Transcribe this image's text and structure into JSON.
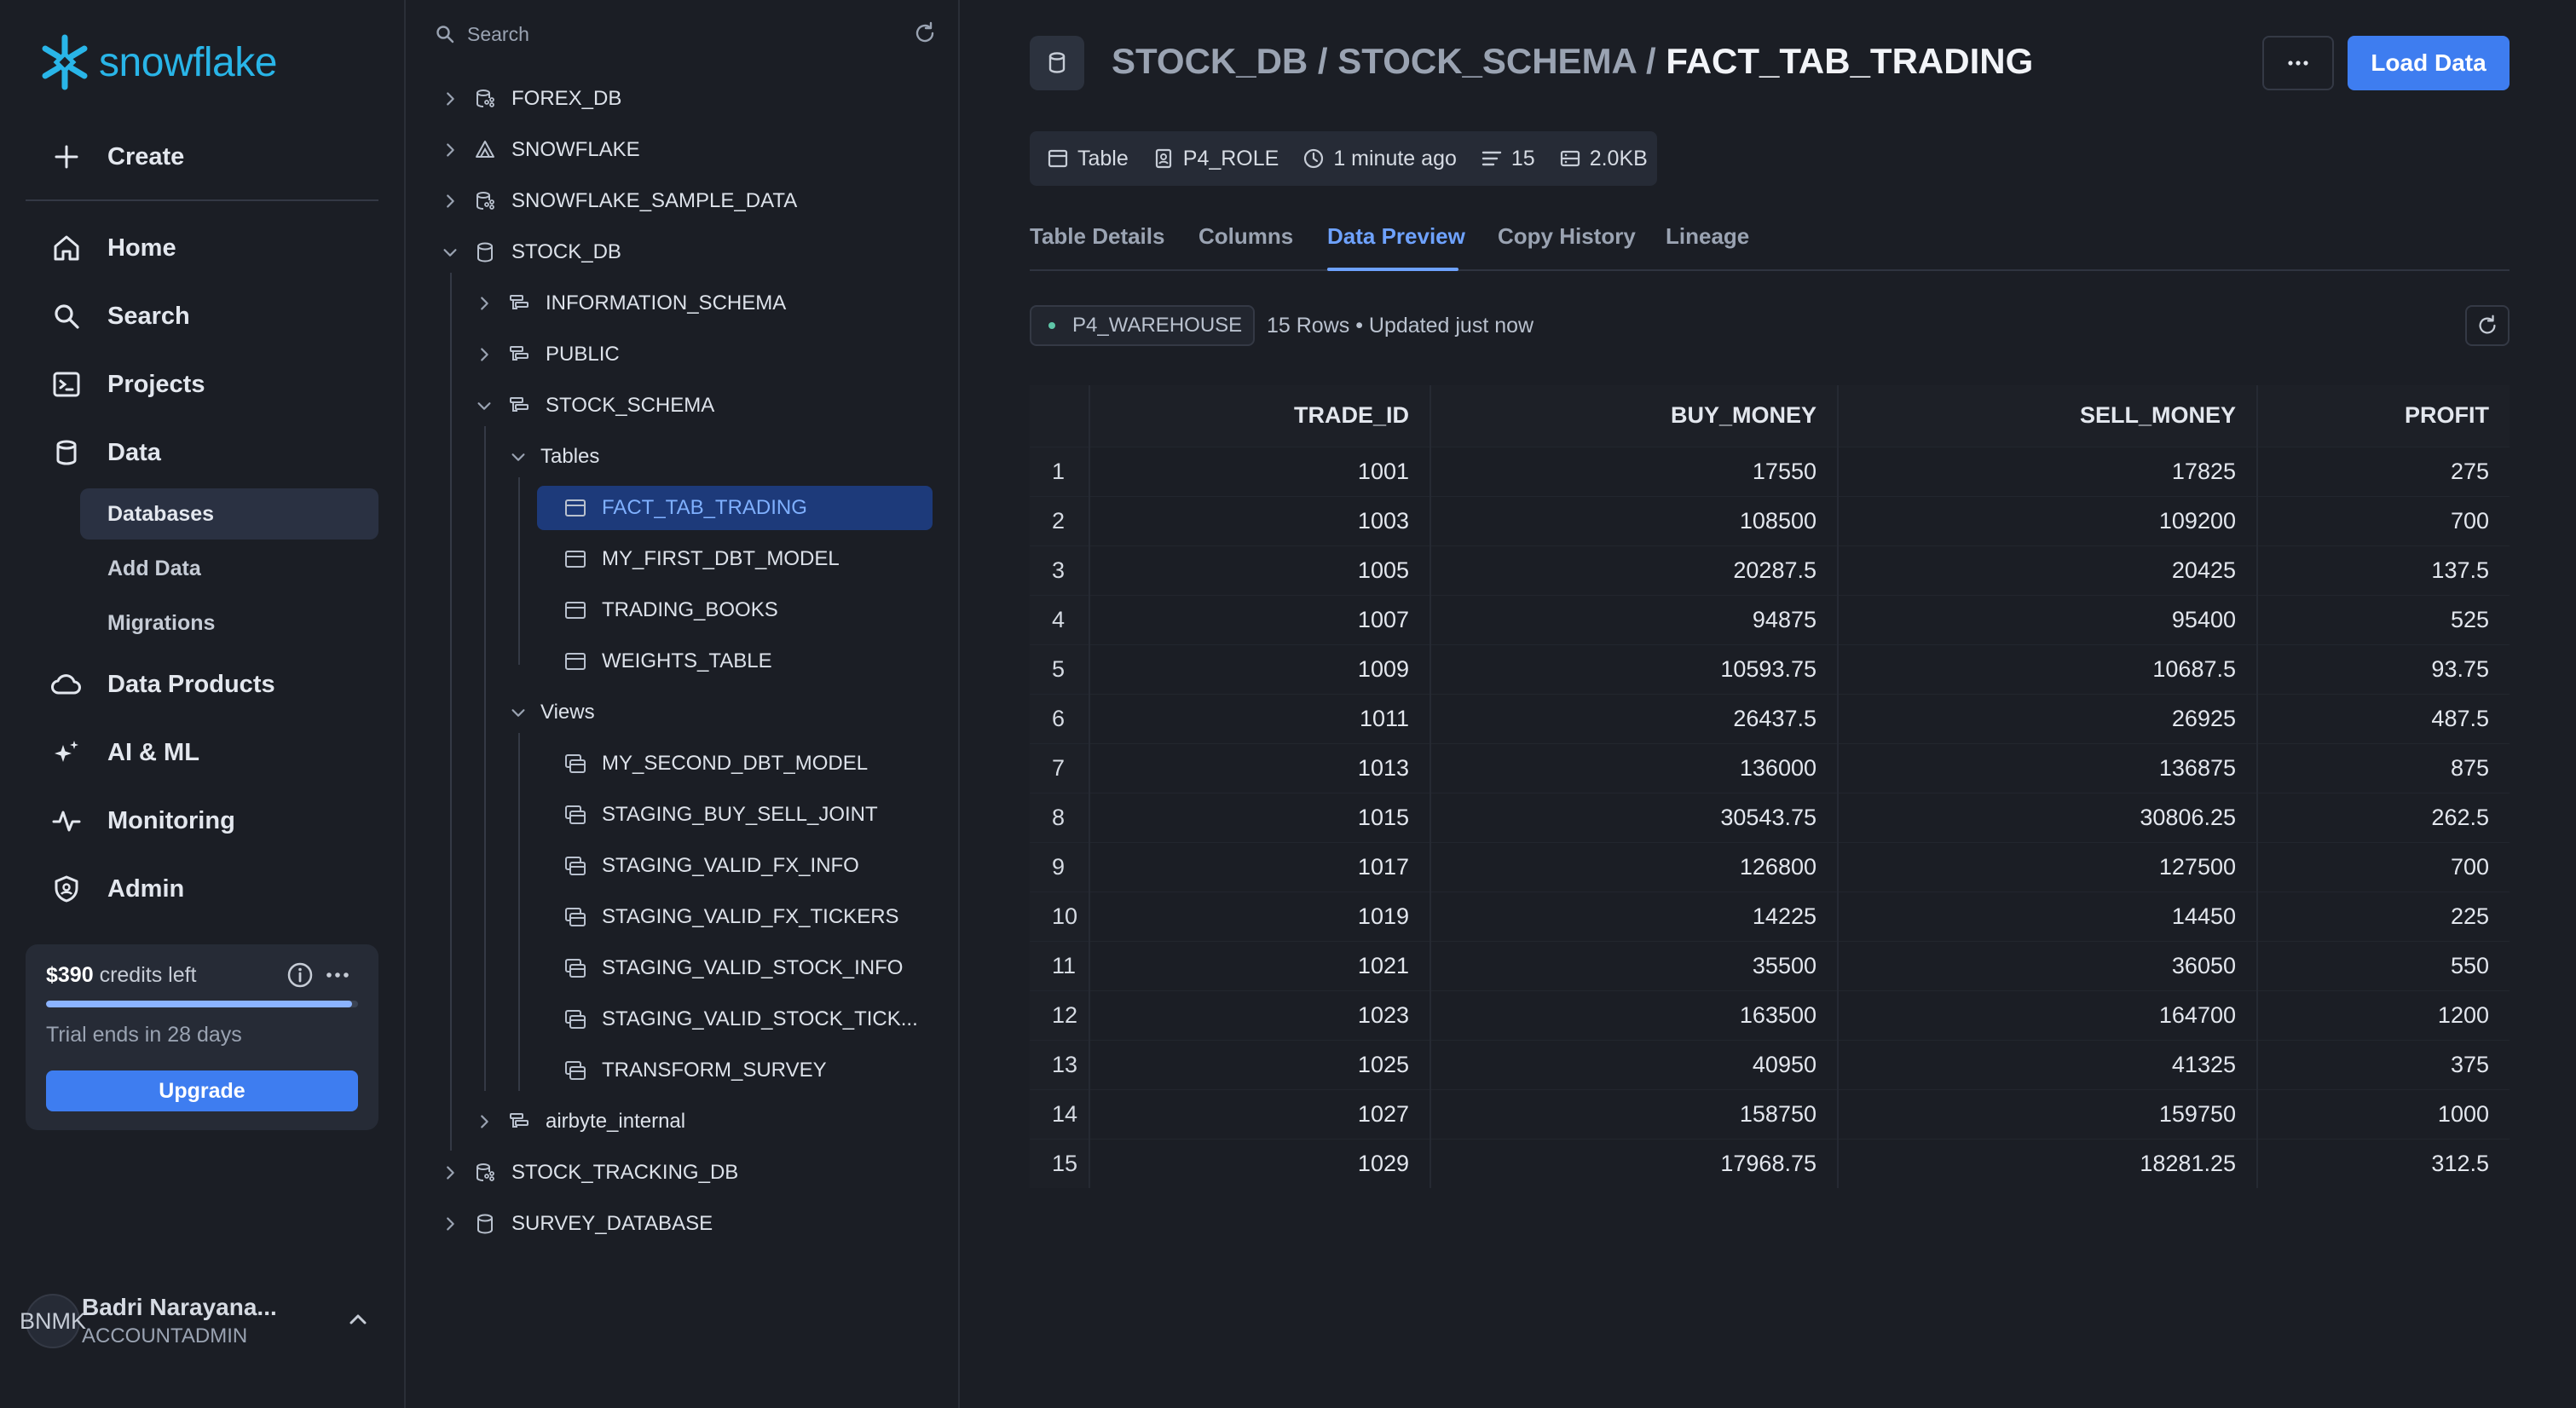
{
  "brand": {
    "logo_text": "snowflake",
    "accent": "#29b5e8"
  },
  "nav": {
    "create": "Create",
    "items": [
      {
        "label": "Home",
        "icon": "home-icon"
      },
      {
        "label": "Search",
        "icon": "search-icon"
      },
      {
        "label": "Projects",
        "icon": "terminal-icon"
      },
      {
        "label": "Data",
        "icon": "database-icon"
      }
    ],
    "data_sub": [
      "Databases",
      "Add Data",
      "Migrations"
    ],
    "items_after": [
      {
        "label": "Data Products",
        "icon": "cloud-icon"
      },
      {
        "label": "AI & ML",
        "icon": "sparkle-icon"
      },
      {
        "label": "Monitoring",
        "icon": "pulse-icon"
      },
      {
        "label": "Admin",
        "icon": "shield-icon"
      }
    ]
  },
  "credits": {
    "amount": "$390",
    "suffix": "credits left",
    "trial": "Trial ends in 28 days",
    "upgrade": "Upgrade",
    "used_fraction": 0.98
  },
  "user": {
    "initials": "BNMK",
    "name": "Badri Narayana...",
    "role": "ACCOUNTADMIN"
  },
  "tree": {
    "search_placeholder": "Search",
    "rows": [
      "FOREX_DB",
      "SNOWFLAKE",
      "SNOWFLAKE_SAMPLE_DATA",
      "STOCK_DB",
      "INFORMATION_SCHEMA",
      "PUBLIC",
      "STOCK_SCHEMA",
      "Tables",
      "FACT_TAB_TRADING",
      "MY_FIRST_DBT_MODEL",
      "TRADING_BOOKS",
      "WEIGHTS_TABLE",
      "Views",
      "MY_SECOND_DBT_MODEL",
      "STAGING_BUY_SELL_JOINT",
      "STAGING_VALID_FX_INFO",
      "STAGING_VALID_FX_TICKERS",
      "STAGING_VALID_STOCK_INFO",
      "STAGING_VALID_STOCK_TICK...",
      "TRANSFORM_SURVEY",
      "airbyte_internal",
      "STOCK_TRACKING_DB",
      "SURVEY_DATABASE"
    ]
  },
  "header": {
    "crumb_db": "STOCK_DB",
    "crumb_schema": "STOCK_SCHEMA",
    "crumb_sep": " / ",
    "crumb_table": "FACT_TAB_TRADING",
    "load_data": "Load Data"
  },
  "meta": {
    "type": "Table",
    "role": "P4_ROLE",
    "updated": "1 minute ago",
    "rows": "15",
    "size": "2.0KB"
  },
  "tabs": [
    "Table Details",
    "Columns",
    "Data Preview",
    "Copy History",
    "Lineage"
  ],
  "active_tab": "Data Preview",
  "preview": {
    "warehouse": "P4_WAREHOUSE",
    "rows_info": "15 Rows • Updated just now",
    "columns": [
      "TRADE_ID",
      "BUY_MONEY",
      "SELL_MONEY",
      "PROFIT"
    ],
    "rows": [
      [
        "1",
        "1001",
        "17550",
        "17825",
        "275"
      ],
      [
        "2",
        "1003",
        "108500",
        "109200",
        "700"
      ],
      [
        "3",
        "1005",
        "20287.5",
        "20425",
        "137.5"
      ],
      [
        "4",
        "1007",
        "94875",
        "95400",
        "525"
      ],
      [
        "5",
        "1009",
        "10593.75",
        "10687.5",
        "93.75"
      ],
      [
        "6",
        "1011",
        "26437.5",
        "26925",
        "487.5"
      ],
      [
        "7",
        "1013",
        "136000",
        "136875",
        "875"
      ],
      [
        "8",
        "1015",
        "30543.75",
        "30806.25",
        "262.5"
      ],
      [
        "9",
        "1017",
        "126800",
        "127500",
        "700"
      ],
      [
        "10",
        "1019",
        "14225",
        "14450",
        "225"
      ],
      [
        "11",
        "1021",
        "35500",
        "36050",
        "550"
      ],
      [
        "12",
        "1023",
        "163500",
        "164700",
        "1200"
      ],
      [
        "13",
        "1025",
        "40950",
        "41325",
        "375"
      ],
      [
        "14",
        "1027",
        "158750",
        "159750",
        "1000"
      ],
      [
        "15",
        "1029",
        "17968.75",
        "18281.25",
        "312.5"
      ]
    ]
  }
}
